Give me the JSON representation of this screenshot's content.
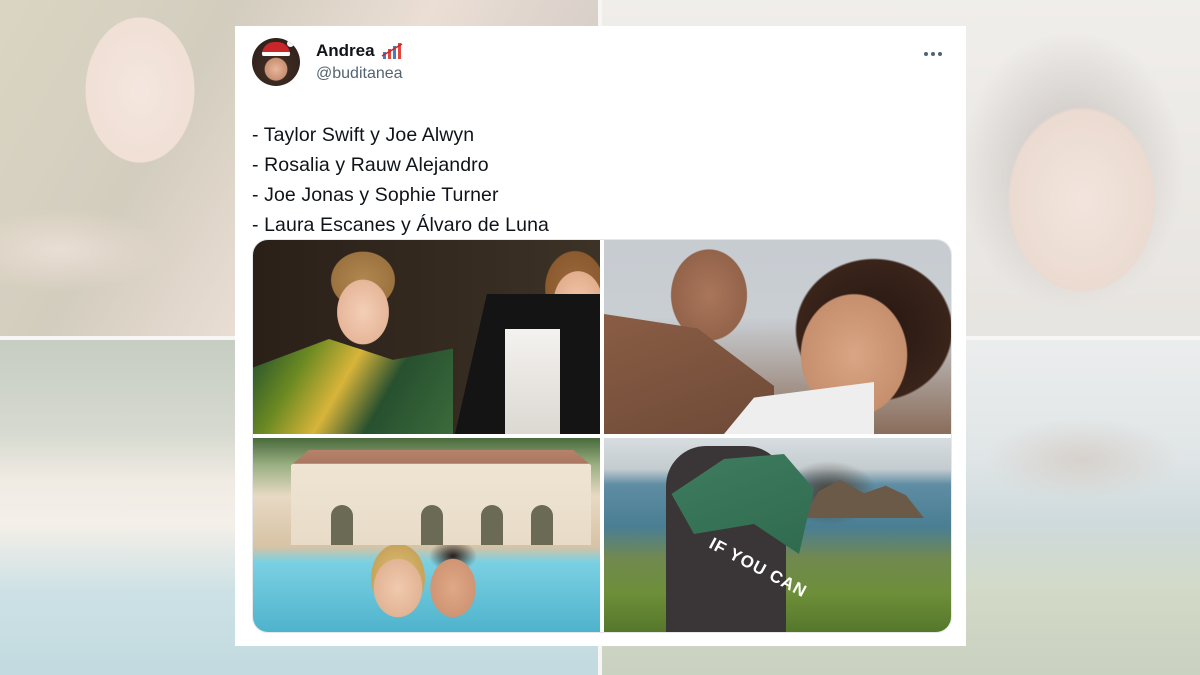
{
  "tweet": {
    "display_name": "Andrea",
    "handle": "@buditanea",
    "lines": [
      "- Taylor Swift y Joe Alwyn",
      "- Rosalia y Rauw Alejandro",
      "- Joe Jonas y Sophie Turner",
      "- Laura Escanes y Álvaro de Luna"
    ],
    "more_icon": "more-horizontal-icon",
    "name_emoji_icon": "chart-emoji-icon"
  },
  "media": {
    "photos": [
      {
        "name": "photo-taylor-swift-joe-alwyn"
      },
      {
        "name": "photo-rosalia-rauw-alejandro"
      },
      {
        "name": "photo-joe-jonas-sophie-turner"
      },
      {
        "name": "photo-laura-escanes-alvaro-de-luna"
      }
    ],
    "hoodie_print": "IF YOU CAN"
  },
  "colors": {
    "text_primary": "#0f1419",
    "text_secondary": "#536471",
    "card_background": "#ffffff"
  }
}
